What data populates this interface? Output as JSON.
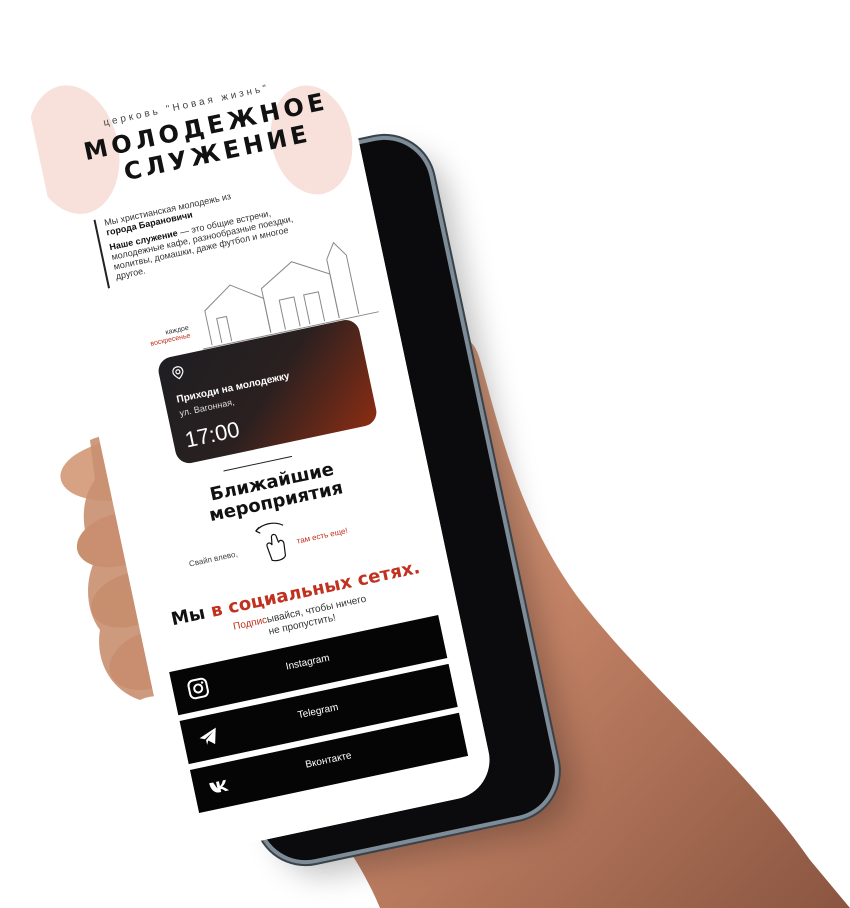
{
  "app": {
    "church_name": "церковь \"Новая жизнь\"",
    "title_line1": "МОЛОДЕЖНОЕ",
    "title_line2": "СЛУЖЕНИЕ"
  },
  "about": {
    "intro": "Мы христианская молодежь из",
    "city": "города Барановичи",
    "service_title": "Наше служение",
    "service_text": " — это общие встречи, молодежные кафе, разнообразные поездки, молитвы, домашки, даже футбол и многое другое."
  },
  "event": {
    "day_label_1": "каждое",
    "day_label_2": "воскресенье",
    "title": "Приходи на молодежку",
    "address": "ул. Вагонная,",
    "time": "17:00",
    "pin_icon": "location-pin-icon"
  },
  "events_section": {
    "title_1": "Ближайшие",
    "title_2": "мероприятия",
    "swipe_left": "Свайп влево,",
    "swipe_more": "там есть еще!"
  },
  "social": {
    "title_pre": "Мы ",
    "title_highlight": "в социальных сетях.",
    "subtitle_highlight": "Подпис",
    "subtitle_rest": "ывайся, чтобы ничего",
    "subtitle_line2": "не пропустить!",
    "buttons": [
      {
        "label": "Instagram",
        "icon": "instagram-icon"
      },
      {
        "label": "Telegram",
        "icon": "telegram-icon"
      },
      {
        "label": "Вконтакте",
        "icon": "vk-icon"
      }
    ]
  },
  "colors": {
    "accent": "#c0311f",
    "button_bg": "#050505",
    "brush": "#f6d6cf"
  }
}
